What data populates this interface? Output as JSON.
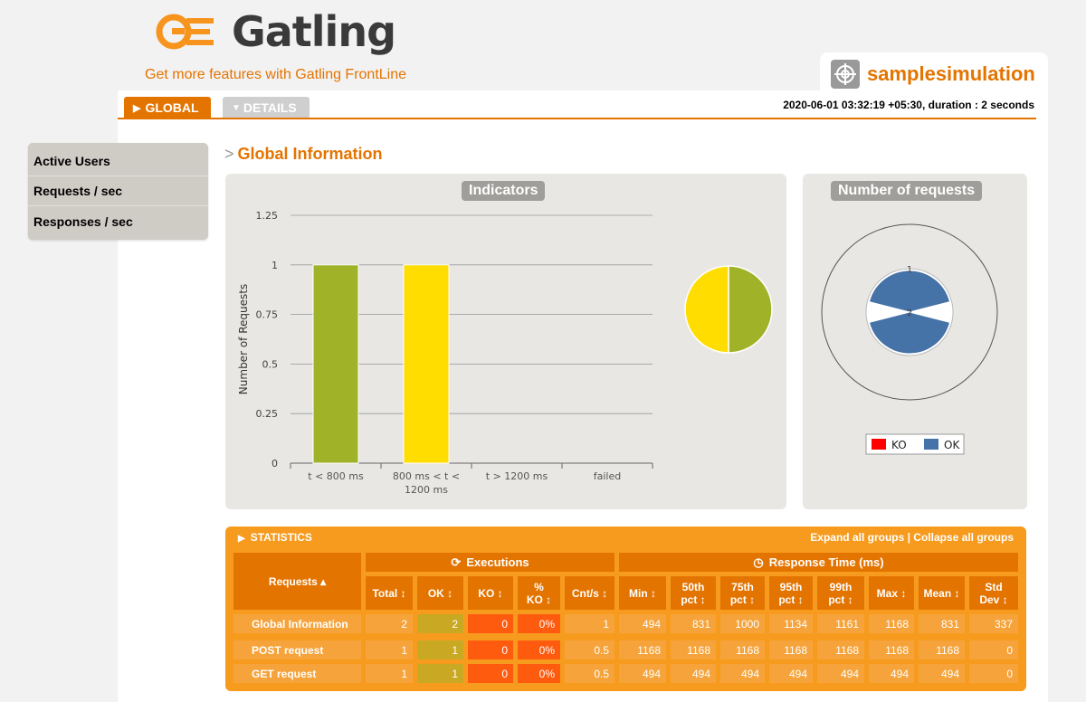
{
  "header": {
    "brand": "Gatling",
    "frontline_link": "Get more features with Gatling FrontLine",
    "simulation_name": "samplesimulation",
    "run_info": "2020-06-01 03:32:19 +05:30, duration : 2 seconds"
  },
  "tabs": [
    {
      "label": "GLOBAL",
      "icon": "triangle-right-icon",
      "active": true
    },
    {
      "label": "DETAILS",
      "icon": "triangle-down-icon",
      "active": false
    }
  ],
  "side_menu": [
    "Active Users",
    "Requests / sec",
    "Responses / sec"
  ],
  "section_title": "Global Information",
  "indicators": {
    "title": "Indicators",
    "chart_data": {
      "type": "bar",
      "ylabel": "Number of Requests",
      "ylim": [
        0,
        1.25
      ],
      "yticks": [
        "0",
        "0.25",
        "0.5",
        "0.75",
        "1",
        "1.25"
      ],
      "categories": [
        "t < 800 ms",
        "800 ms < t <",
        "t > 1200 ms",
        "failed"
      ],
      "category_second_line": [
        "",
        "1200 ms",
        "",
        ""
      ],
      "values": [
        1,
        1,
        0,
        0
      ],
      "colors": [
        "#a0b228",
        "#ffdd00",
        "#f15b4f",
        "#e47400"
      ]
    },
    "pie": {
      "type": "pie",
      "values": [
        1,
        1
      ],
      "colors": [
        "#a0b228",
        "#ffdd00"
      ]
    }
  },
  "requests_chart": {
    "title": "Number of requests",
    "chart_data": {
      "type": "pie",
      "center_label": "2",
      "outer_label": "1",
      "series": [
        {
          "name": "KO",
          "value": 0,
          "color": "#ff0000"
        },
        {
          "name": "OK",
          "value": 2,
          "color": "#4572a7"
        }
      ]
    },
    "legend": [
      {
        "label": "KO",
        "color": "#ff0000"
      },
      {
        "label": "OK",
        "color": "#4572a7"
      }
    ]
  },
  "statistics": {
    "label": "STATISTICS",
    "links": "Expand all groups | Collapse all groups",
    "requests_header": "Requests",
    "executions_header": "Executions",
    "response_time_header": "Response Time (ms)",
    "columns": [
      "Total",
      "OK",
      "KO",
      "% KO",
      "Cnt/s",
      "Min",
      "50th pct",
      "75th pct",
      "95th pct",
      "99th pct",
      "Max",
      "Mean",
      "Std Dev"
    ],
    "rows": [
      {
        "name": "Global Information",
        "values": [
          "2",
          "2",
          "0",
          "0%",
          "1",
          "494",
          "831",
          "1000",
          "1134",
          "1161",
          "1168",
          "831",
          "337"
        ]
      },
      {
        "name": "POST request",
        "values": [
          "1",
          "1",
          "0",
          "0%",
          "0.5",
          "1168",
          "1168",
          "1168",
          "1168",
          "1168",
          "1168",
          "1168",
          "0"
        ]
      },
      {
        "name": "GET request",
        "values": [
          "1",
          "1",
          "0",
          "0%",
          "0.5",
          "494",
          "494",
          "494",
          "494",
          "494",
          "494",
          "494",
          "0"
        ]
      }
    ]
  }
}
